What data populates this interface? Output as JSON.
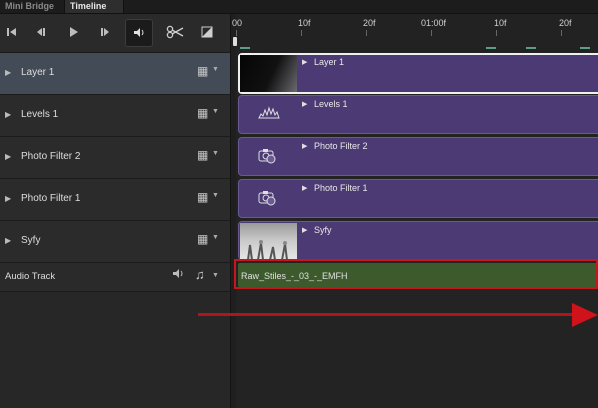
{
  "tabs": [
    {
      "label": "Mini Bridge"
    },
    {
      "label": "Timeline"
    }
  ],
  "controls": {
    "goto_first_icon": "skip-to-start-icon",
    "prev_frame_icon": "previous-frame-icon",
    "play_icon": "play-icon",
    "next_frame_icon": "next-frame-icon",
    "audio_icon": "speaker-icon",
    "split_icon": "scissors-icon",
    "transition_icon": "transition-icon"
  },
  "tracks": [
    {
      "label": "Layer 1",
      "clip_label": "Layer 1",
      "selected": true
    },
    {
      "label": "Levels 1",
      "clip_label": "Levels 1",
      "selected": false
    },
    {
      "label": "Photo Filter 2",
      "clip_label": "Photo Filter 2",
      "selected": false
    },
    {
      "label": "Photo Filter 1",
      "clip_label": "Photo Filter 1",
      "selected": false
    },
    {
      "label": "Syfy",
      "clip_label": "Syfy",
      "selected": false
    }
  ],
  "audio_track": {
    "label": "Audio Track",
    "clip_label": "Raw_Stiles_-_03_-_EMFH"
  },
  "ruler": [
    "00",
    "10f",
    "20f",
    "01:00f",
    "10f",
    "20f"
  ],
  "colors": {
    "clip_purple": "#4b3a73",
    "audio_green": "#3c5a2c",
    "highlight_red": "#c8161e",
    "selected_track": "#434b57"
  }
}
